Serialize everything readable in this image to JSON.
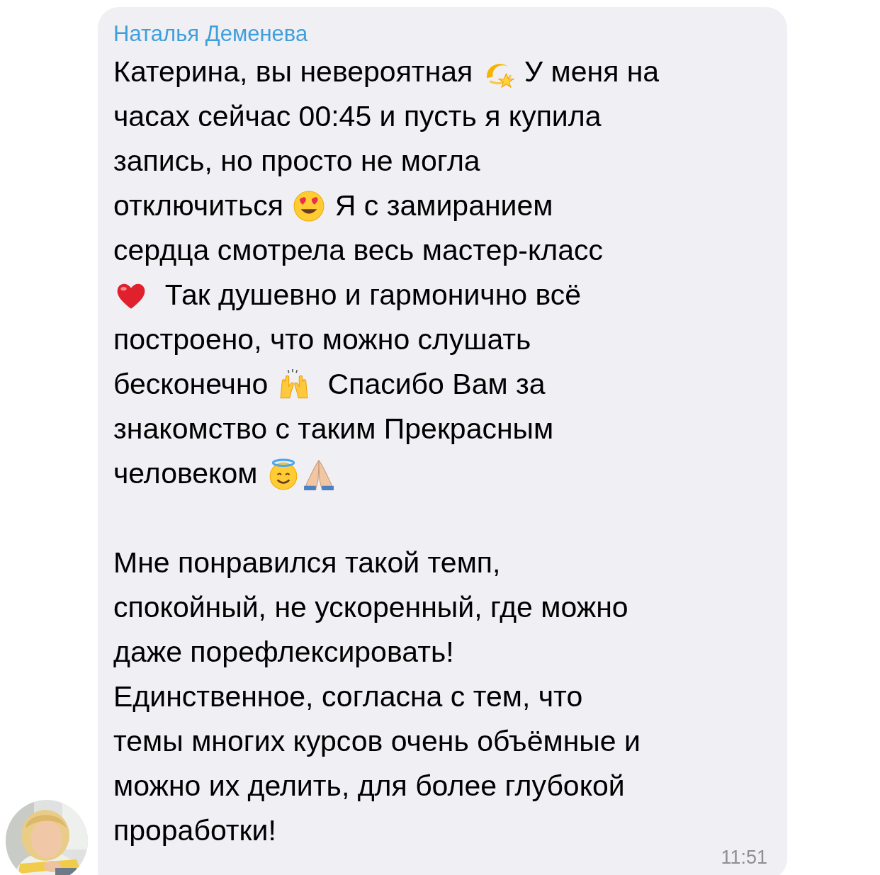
{
  "message": {
    "sender": "Наталья Деменева",
    "paragraphs": [
      {
        "lines": [
          [
            {
              "kind": "text",
              "text": "Катерина, вы невероятная "
            },
            {
              "kind": "dizzy"
            },
            {
              "kind": "text",
              "text": " У меня на"
            }
          ],
          [
            {
              "kind": "text",
              "text": "часах сейчас 00:45 и пусть я купила"
            }
          ],
          [
            {
              "kind": "text",
              "text": "запись, но просто не могла"
            }
          ],
          [
            {
              "kind": "text",
              "text": "отключиться "
            },
            {
              "kind": "heart-eyes"
            },
            {
              "kind": "text",
              "text": " Я с замиранием"
            }
          ],
          [
            {
              "kind": "text",
              "text": "сердца смотрела весь мастер-класс"
            }
          ],
          [
            {
              "kind": "heart"
            },
            {
              "kind": "text",
              "text": "  Так душевно и гармонично всё"
            }
          ],
          [
            {
              "kind": "text",
              "text": "построено, что можно слушать"
            }
          ],
          [
            {
              "kind": "text",
              "text": "бесконечно "
            },
            {
              "kind": "raised-hands"
            },
            {
              "kind": "text",
              "text": "  Спасибо Вам за"
            }
          ],
          [
            {
              "kind": "text",
              "text": "знакомство с таким Прекрасным"
            }
          ],
          [
            {
              "kind": "text",
              "text": "человеком "
            },
            {
              "kind": "halo"
            },
            {
              "kind": "pray"
            }
          ]
        ]
      },
      {
        "lines": [
          [
            {
              "kind": "text",
              "text": "Мне понравился такой темп,"
            }
          ],
          [
            {
              "kind": "text",
              "text": "спокойный, не ускоренный, где можно"
            }
          ],
          [
            {
              "kind": "text",
              "text": "даже порефлексировать!"
            }
          ],
          [
            {
              "kind": "text",
              "text": "Единственное, согласна с тем, что"
            }
          ],
          [
            {
              "kind": "text",
              "text": "темы многих курсов очень объёмные и"
            }
          ],
          [
            {
              "kind": "text",
              "text": "можно их делить, для более глубокой"
            }
          ],
          [
            {
              "kind": "text",
              "text": "проработки!"
            }
          ]
        ]
      }
    ],
    "time": "11:51"
  }
}
